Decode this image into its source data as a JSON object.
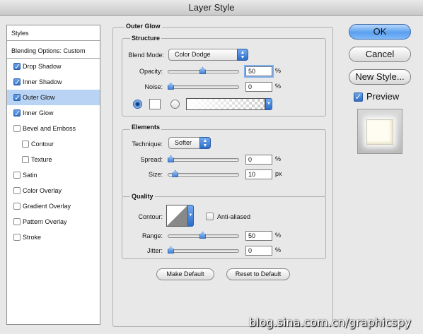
{
  "window": {
    "title": "Layer Style"
  },
  "styles_panel": {
    "header": "Styles",
    "blending_options": "Blending Options: Custom",
    "items": [
      {
        "label": "Drop Shadow",
        "checked": true,
        "indent": false,
        "selected": false
      },
      {
        "label": "Inner Shadow",
        "checked": true,
        "indent": false,
        "selected": false
      },
      {
        "label": "Outer Glow",
        "checked": true,
        "indent": false,
        "selected": true
      },
      {
        "label": "Inner Glow",
        "checked": true,
        "indent": false,
        "selected": false
      },
      {
        "label": "Bevel and Emboss",
        "checked": false,
        "indent": false,
        "selected": false
      },
      {
        "label": "Contour",
        "checked": false,
        "indent": true,
        "selected": false
      },
      {
        "label": "Texture",
        "checked": false,
        "indent": true,
        "selected": false
      },
      {
        "label": "Satin",
        "checked": false,
        "indent": false,
        "selected": false
      },
      {
        "label": "Color Overlay",
        "checked": false,
        "indent": false,
        "selected": false
      },
      {
        "label": "Gradient Overlay",
        "checked": false,
        "indent": false,
        "selected": false
      },
      {
        "label": "Pattern Overlay",
        "checked": false,
        "indent": false,
        "selected": false
      },
      {
        "label": "Stroke",
        "checked": false,
        "indent": false,
        "selected": false
      }
    ]
  },
  "outer_glow": {
    "title": "Outer Glow",
    "structure": {
      "title": "Structure",
      "blend_mode_label": "Blend Mode:",
      "blend_mode_value": "Color Dodge",
      "opacity_label": "Opacity:",
      "opacity_value": "50",
      "opacity_level": 0.5,
      "noise_label": "Noise:",
      "noise_value": "0",
      "noise_level": 0,
      "percent": "%"
    },
    "elements": {
      "title": "Elements",
      "technique_label": "Technique:",
      "technique_value": "Softer",
      "spread_label": "Spread:",
      "spread_value": "0",
      "spread_level": 0,
      "size_label": "Size:",
      "size_value": "10",
      "size_level": 0.07,
      "percent": "%",
      "px": "px"
    },
    "quality": {
      "title": "Quality",
      "contour_label": "Contour:",
      "anti_aliased_label": "Anti-aliased",
      "anti_aliased_checked": false,
      "range_label": "Range:",
      "range_value": "50",
      "range_level": 0.5,
      "jitter_label": "Jitter:",
      "jitter_value": "0",
      "jitter_level": 0,
      "percent": "%"
    },
    "make_default": "Make Default",
    "reset_default": "Reset to Default"
  },
  "buttons": {
    "ok": "OK",
    "cancel": "Cancel",
    "new_style": "New Style...",
    "preview_label": "Preview",
    "preview_checked": true
  },
  "watermark": "blog.sina.com.cn/graphicspy"
}
